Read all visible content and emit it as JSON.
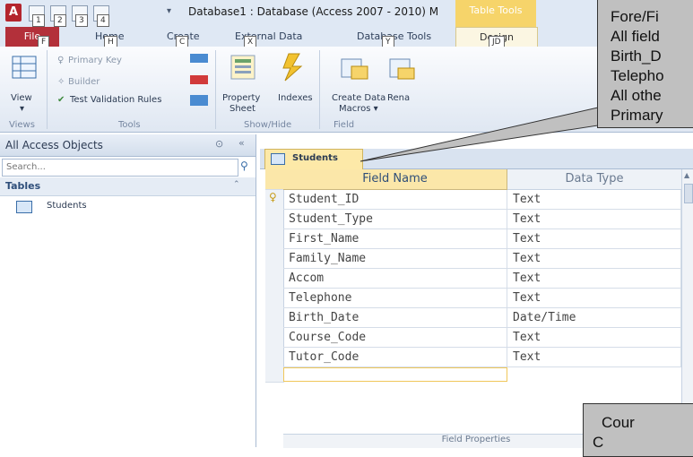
{
  "window": {
    "title": "Database1 : Database (Access 2007 - 2010) M",
    "table_tools_label": "Table Tools",
    "app_icon_letter": "A",
    "qat_keytips": [
      "1",
      "2",
      "3",
      "4"
    ]
  },
  "ribbon_tabs": [
    {
      "label": "File",
      "keytip": "F"
    },
    {
      "label": "Home",
      "keytip": "H"
    },
    {
      "label": "Create",
      "keytip": "C"
    },
    {
      "label": "External Data",
      "keytip": "X"
    },
    {
      "label": "Database Tools",
      "keytip": "Y"
    },
    {
      "label": "Design",
      "keytip": "JD"
    }
  ],
  "ribbon": {
    "view_label": "View",
    "primary_key_label": "Primary Key",
    "builder_label": "Builder",
    "test_validation_label": "Test Validation Rules",
    "property_sheet_label_1": "Property",
    "property_sheet_label_2": "Sheet",
    "indexes_label": "Indexes",
    "create_data_macros_1": "Create Data",
    "create_data_macros_2": "Macros",
    "rename_label": "Rena",
    "groups": {
      "views": "Views",
      "tools": "Tools",
      "show_hide": "Show/Hide",
      "field": "Field"
    }
  },
  "nav": {
    "header": "All Access Objects",
    "search_placeholder": "Search...",
    "group_label": "Tables",
    "items": [
      {
        "label": "Students"
      }
    ]
  },
  "document": {
    "tab_label": "Students",
    "columns": [
      "Field Name",
      "Data Type"
    ],
    "rows": [
      {
        "field": "Student_ID",
        "type": "Text",
        "primary_key": true
      },
      {
        "field": "Student_Type",
        "type": "Text",
        "primary_key": false
      },
      {
        "field": "First_Name",
        "type": "Text",
        "primary_key": false
      },
      {
        "field": "Family_Name",
        "type": "Text",
        "primary_key": false
      },
      {
        "field": "Accom",
        "type": "Text",
        "primary_key": false
      },
      {
        "field": "Telephone",
        "type": "Text",
        "primary_key": false
      },
      {
        "field": "Birth_Date",
        "type": "Date/Time",
        "primary_key": false
      },
      {
        "field": "Course_Code",
        "type": "Text",
        "primary_key": false
      },
      {
        "field": "Tutor_Code",
        "type": "Text",
        "primary_key": false
      }
    ],
    "field_properties_label": "Field Properties"
  },
  "callouts": {
    "top_lines": [
      "Fore/Fi",
      "All field",
      "Birth_D",
      "Telepho",
      "All othe",
      "Primary"
    ],
    "bottom_lines": [
      "Cour",
      "C"
    ]
  },
  "colors": {
    "file_tab": "#b3303a",
    "table_tools": "#f6d46a",
    "grid_header": "#fbe7a9",
    "callout_bg": "#c0c0c0"
  }
}
